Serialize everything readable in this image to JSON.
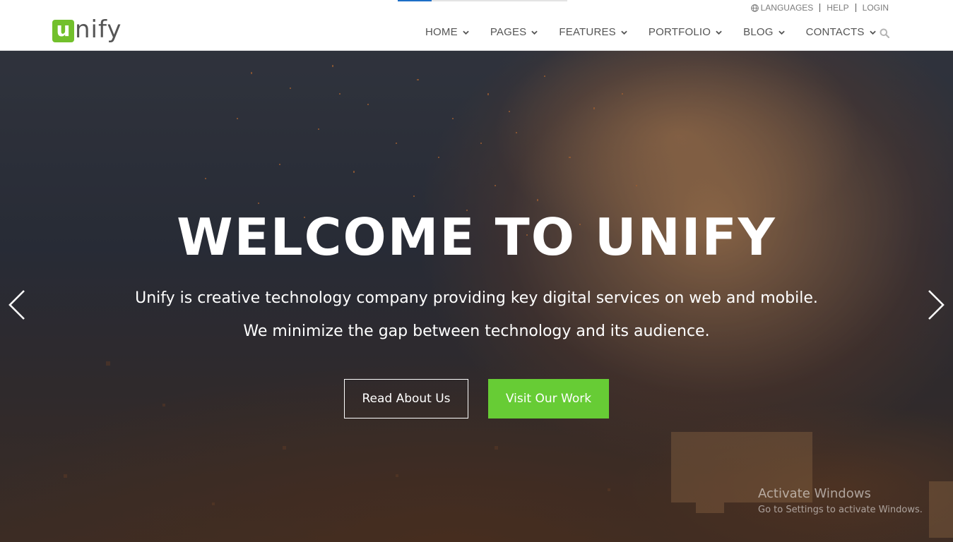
{
  "colors": {
    "brand_green": "#72c02c",
    "button_green": "#67cc35",
    "nav_text": "#555555",
    "loader_blue": "#1d6fc7"
  },
  "logo": {
    "first_letter": "u",
    "rest": "nify"
  },
  "topbar": {
    "languages": "LANGUAGES",
    "help": "HELP",
    "login": "LOGIN",
    "languages_icon": "globe-icon"
  },
  "nav": {
    "items": [
      {
        "label": "HOME"
      },
      {
        "label": "PAGES"
      },
      {
        "label": "FEATURES"
      },
      {
        "label": "PORTFOLIO"
      },
      {
        "label": "BLOG"
      },
      {
        "label": "CONTACTS"
      }
    ],
    "dropdown_icon": "chevron-down-icon",
    "search_icon": "search-icon"
  },
  "hero": {
    "title": "WELCOME TO UNIFY",
    "subtitle_line1": "Unify is creative technology company providing key digital services on web and mobile.",
    "subtitle_line2": "We minimize the gap between technology and its audience.",
    "primary_button": "Read About Us",
    "secondary_button": "Visit Our Work",
    "prev_icon": "chevron-left-icon",
    "next_icon": "chevron-right-icon"
  },
  "watermark": {
    "title": "Activate Windows",
    "subtitle": "Go to Settings to activate Windows."
  }
}
